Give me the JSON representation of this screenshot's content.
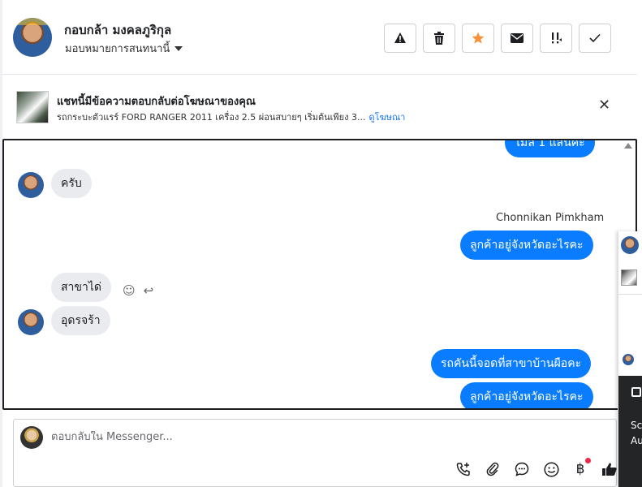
{
  "header": {
    "contact_name": "กอบกล้า มงคลภูริกุล",
    "assign_label": "มอบหมายการสนทนานี้",
    "actions": [
      {
        "name": "report-spam-button",
        "icon": "warning-icon",
        "glyph": "▲"
      },
      {
        "name": "delete-button",
        "icon": "trash-icon",
        "glyph": "🗑"
      },
      {
        "name": "star-button",
        "icon": "star-icon",
        "glyph": "★",
        "color": "#f7923b"
      },
      {
        "name": "mark-unread-button",
        "icon": "envelope-icon",
        "glyph": "✉"
      },
      {
        "name": "follow-up-button",
        "icon": "follow-up-icon",
        "glyph": "!!"
      },
      {
        "name": "mark-done-button",
        "icon": "check-icon",
        "glyph": "✓"
      }
    ]
  },
  "banner": {
    "title": "แชทนี้มีข้อความตอบกลับต่อโฆษณาของคุณ",
    "subtitle": "รถกระบะตัวแรร์ FORD RANGER 2011 เครื่อง 2.5 ผ่อนสบายๆ เริ่มต้นเพียง 3...",
    "link": "ดูโฆษณา",
    "close": "✕"
  },
  "chat": {
    "messages": {
      "m0": "ไมล์ 1 แสนค่ะ",
      "m1": "ครับ",
      "sender": "Chonnikan Pimkham",
      "m2": "ลูกค้าอยู่จังหวัดอะไรคะ",
      "m3": "สาขาได่",
      "m4": "อุดรจร้า",
      "m5": "รถคันนี้จอดที่สาขาบ้านผือคะ",
      "m6": "ลูกค้าอยู่จังหวัดอะไรคะ"
    },
    "tools": {
      "react": "☺",
      "reply": "↩"
    }
  },
  "composer": {
    "placeholder": "ตอบกลับใน Messenger...",
    "tools": [
      {
        "name": "call-icon",
        "glyph": "✆"
      },
      {
        "name": "attach-icon",
        "glyph": "⎘"
      },
      {
        "name": "saved-reply-icon",
        "glyph": "💬"
      },
      {
        "name": "emoji-icon",
        "glyph": "☺"
      },
      {
        "name": "payment-icon",
        "glyph": "฿"
      },
      {
        "name": "like-icon",
        "glyph": "👍"
      }
    ]
  },
  "side": {
    "text1": "Sc",
    "text2": "Au"
  },
  "colors": {
    "accent": "#0a7cff",
    "link": "#1877f2",
    "incoming_bubble": "#e9ebef",
    "star": "#f7923b"
  }
}
